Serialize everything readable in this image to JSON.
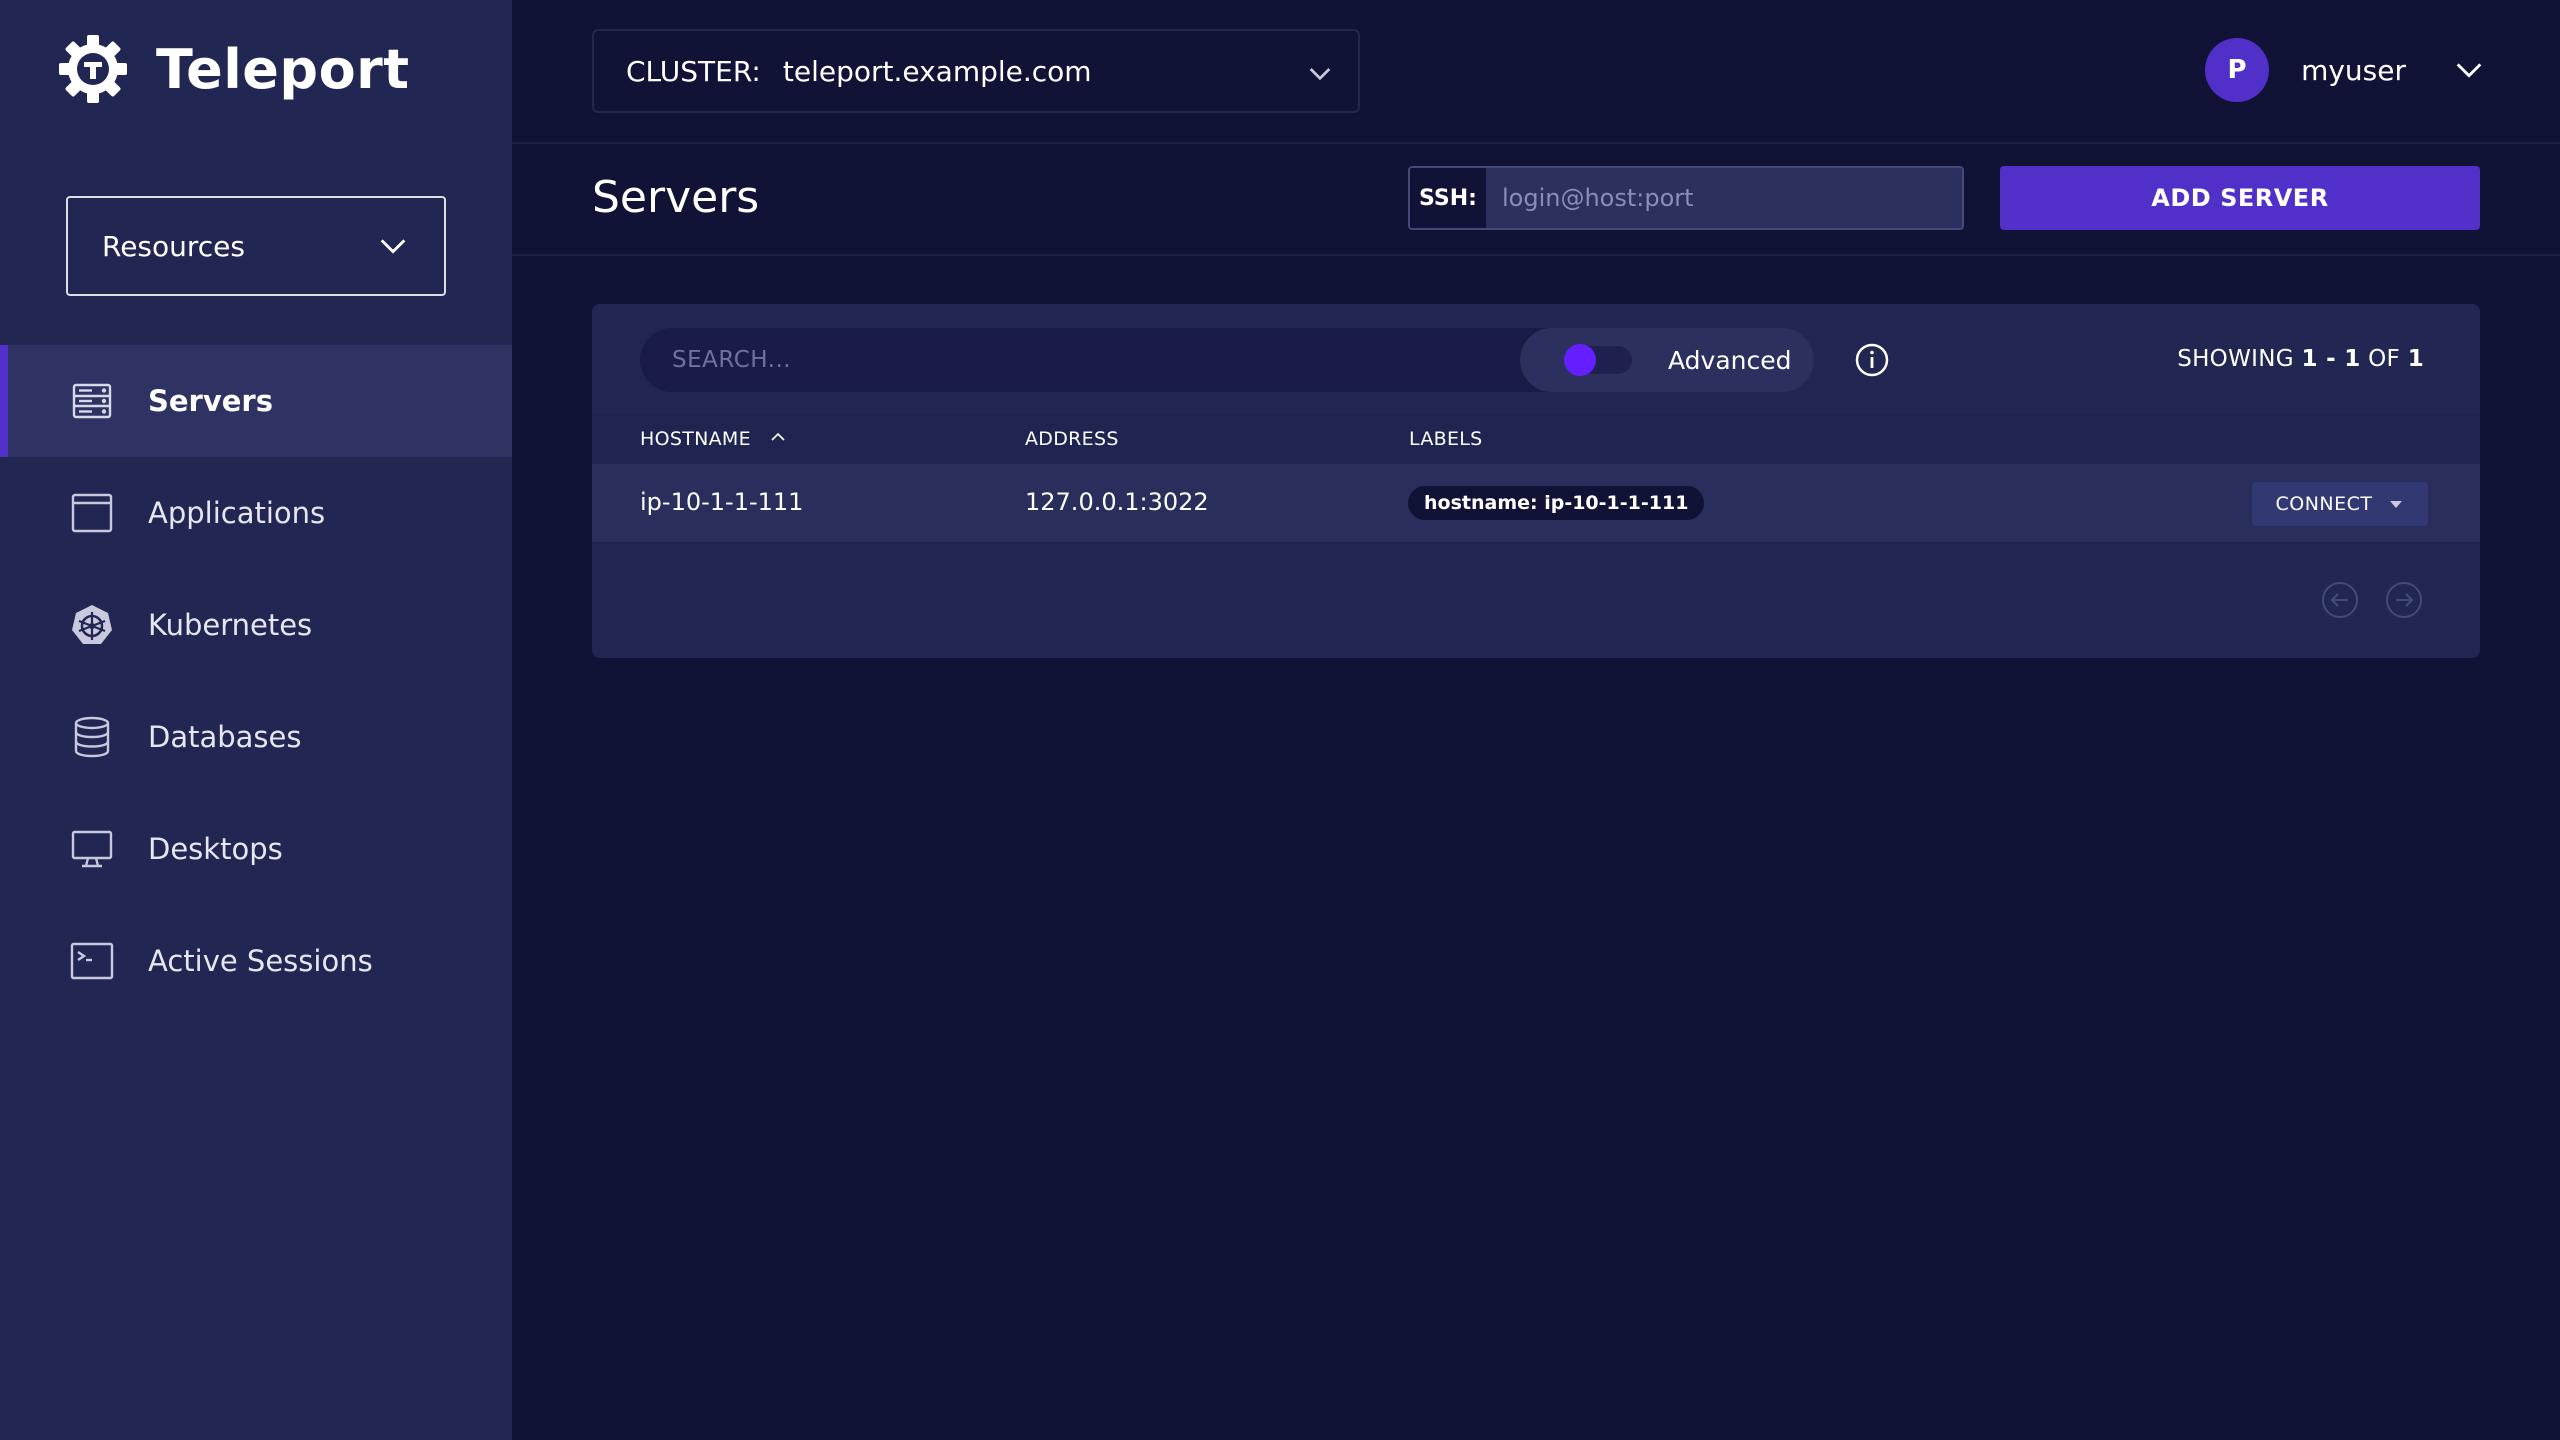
{
  "brand": {
    "name": "Teleport",
    "logo_icon": "teleport-logo-icon"
  },
  "sidebar": {
    "section_select": {
      "label": "Resources",
      "icon": "chevron-down-icon"
    },
    "items": [
      {
        "label": "Servers",
        "icon": "server-icon",
        "active": true
      },
      {
        "label": "Applications",
        "icon": "application-icon",
        "active": false
      },
      {
        "label": "Kubernetes",
        "icon": "kubernetes-icon",
        "active": false
      },
      {
        "label": "Databases",
        "icon": "database-icon",
        "active": false
      },
      {
        "label": "Desktops",
        "icon": "desktop-icon",
        "active": false
      },
      {
        "label": "Active Sessions",
        "icon": "terminal-icon",
        "active": false
      }
    ]
  },
  "topbar": {
    "cluster_label": "CLUSTER:",
    "cluster_value": "teleport.example.com",
    "user_initial": "P",
    "username": "myuser"
  },
  "page": {
    "title": "Servers",
    "ssh_label": "SSH:",
    "ssh_placeholder": "login@host:port",
    "add_server_label": "ADD SERVER"
  },
  "table": {
    "search_placeholder": "SEARCH...",
    "advanced_label": "Advanced",
    "showing_prefix": "SHOWING ",
    "showing_range": "1 - 1",
    "showing_of": " OF ",
    "showing_total": "1",
    "columns": [
      "HOSTNAME",
      "ADDRESS",
      "LABELS"
    ],
    "rows": [
      {
        "hostname": "ip-10-1-1-111",
        "address": "127.0.0.1:3022",
        "label": "hostname: ip-10-1-1-111",
        "action": "CONNECT"
      }
    ]
  },
  "colors": {
    "sidebar_bg": "#222652",
    "main_bg": "#111336",
    "accent": "#512fc9",
    "toggle_knob": "#651fff",
    "panel_bg": "#222652"
  }
}
